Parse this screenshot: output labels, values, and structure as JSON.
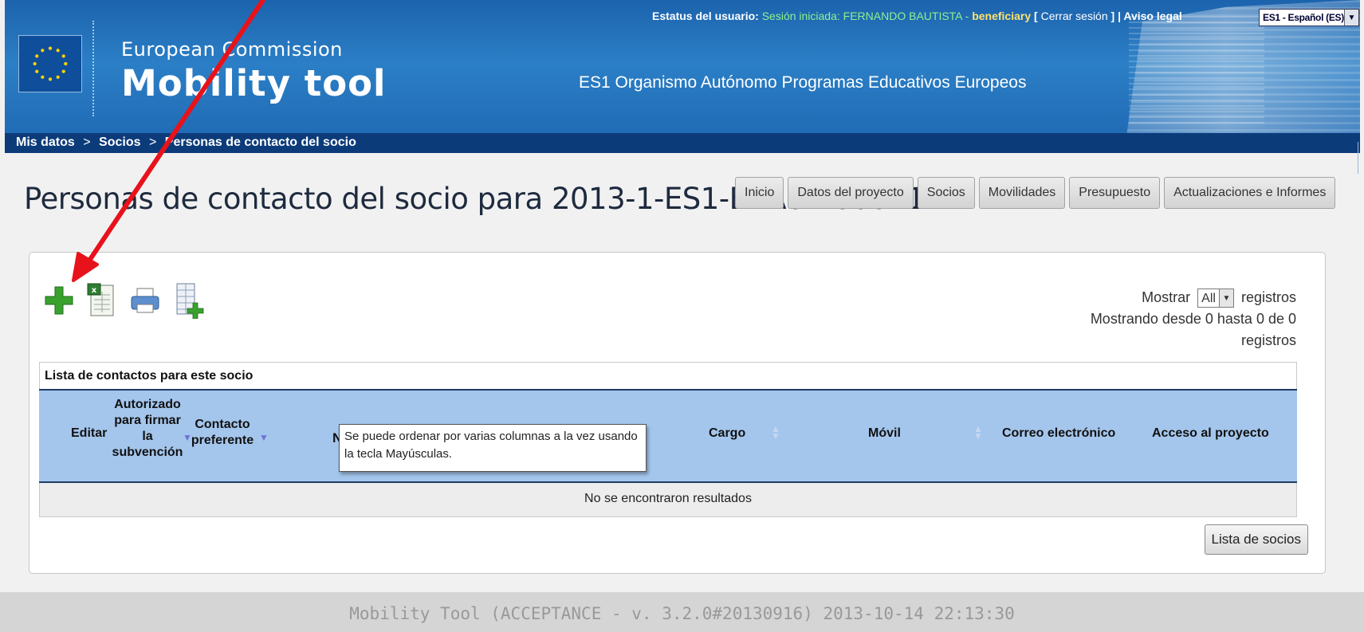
{
  "header": {
    "ec_label": "European Commission",
    "app_name": "Mobility tool",
    "organization": "ES1 Organismo Autónomo Programas Educativos Europeos",
    "status": {
      "prefix": "Estatus del usuario: ",
      "session": "Sesión iniciada: FERNANDO BAUTISTA",
      "dash": " - ",
      "role": "beneficiary",
      "bracket_open": " [ ",
      "logout": "Cerrar sesión",
      "bracket_close": " ]",
      "pipe": " | ",
      "legal": "Aviso legal"
    },
    "language": "ES1 - Español (ES)"
  },
  "breadcrumb": {
    "items": [
      "Mis datos",
      "Socios",
      "Personas de contacto del socio"
    ],
    "separator": ">"
  },
  "page_title": "Personas de contacto del socio para 2013-1-ES1-ERA02-00021",
  "nav": {
    "tabs": [
      "Inicio",
      "Datos del proyecto",
      "Socios",
      "Movilidades",
      "Presupuesto",
      "Actualizaciones e Informes"
    ]
  },
  "toolbar": {
    "icons": [
      "add-icon",
      "excel-export-icon",
      "print-icon",
      "add-column-icon"
    ]
  },
  "show": {
    "prefix": "Mostrar",
    "value": "All",
    "suffix": "registros",
    "info": "Mostrando desde 0 hasta 0 de 0 registros"
  },
  "table": {
    "caption": "Lista de contactos para este socio",
    "columns": {
      "edit": "Editar",
      "authorized": "Autorizado para firmar la subvención",
      "preferred": "Contacto preferente",
      "name_partial": "N",
      "position": "Cargo",
      "mobile": "Móvil",
      "email": "Correo electrónico",
      "access": "Acceso al proyecto"
    },
    "tooltip": "Se puede ordenar por varias columnas a la vez usando la tecla Mayúsculas.",
    "empty": "No se encontraron resultados"
  },
  "partners_button": "Lista de socios",
  "footer": "Mobility Tool (ACCEPTANCE - v. 3.2.0#20130916) 2013-10-14 22:13:30",
  "colors": {
    "header_blue": "#2b7fc6",
    "breadcrumb_bar": "#0c3b7a",
    "table_header": "#a4c6ec",
    "annotation_red": "#e8121b",
    "add_green": "#3aa12f"
  }
}
